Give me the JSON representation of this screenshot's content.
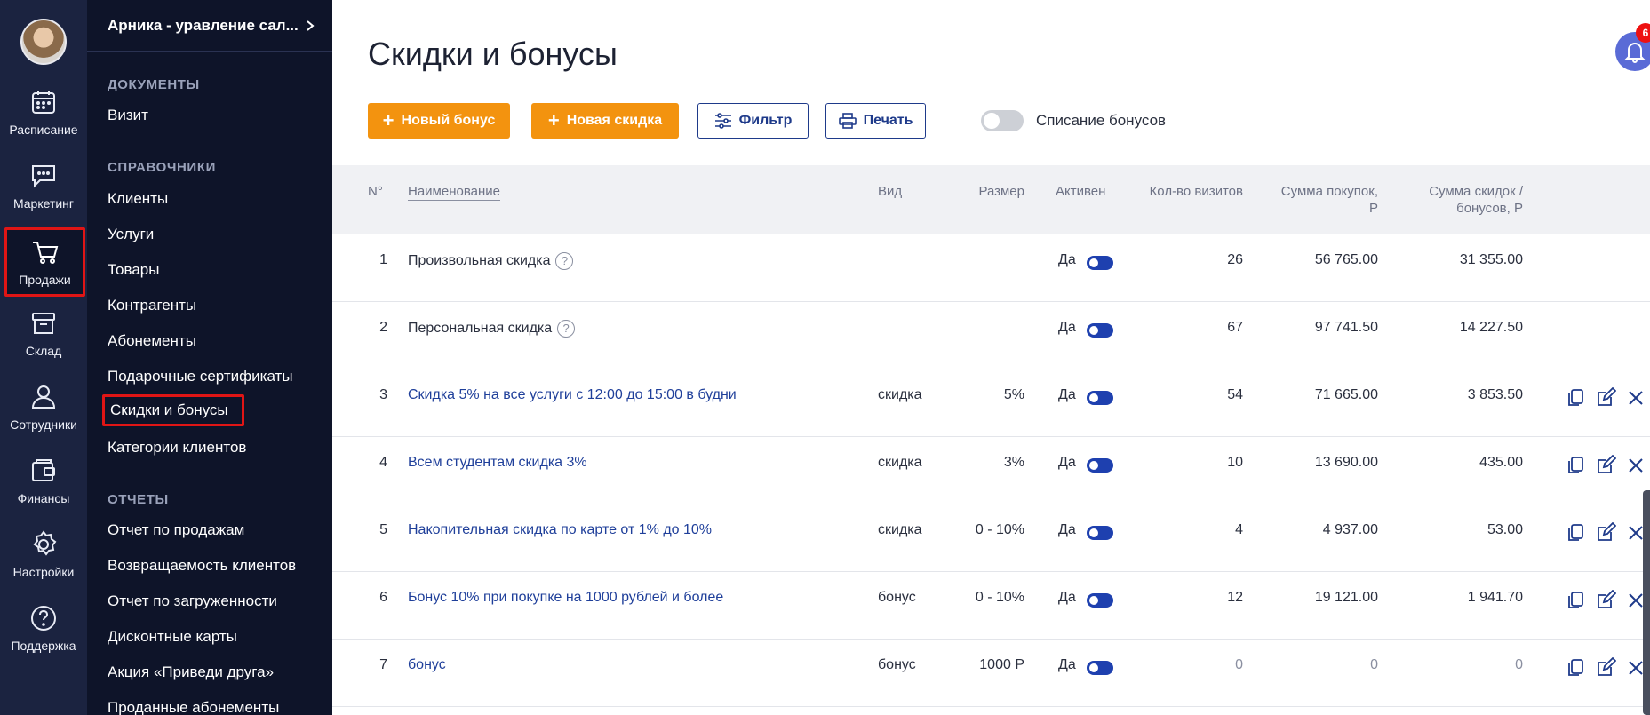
{
  "rail": {
    "items": [
      {
        "label": "Расписание",
        "icon": "calendar-icon"
      },
      {
        "label": "Маркетинг",
        "icon": "chat-icon"
      },
      {
        "label": "Продажи",
        "icon": "cart-icon"
      },
      {
        "label": "Склад",
        "icon": "archive-icon"
      },
      {
        "label": "Сотрудники",
        "icon": "person-icon"
      },
      {
        "label": "Финансы",
        "icon": "wallet-icon"
      },
      {
        "label": "Настройки",
        "icon": "gear-icon"
      },
      {
        "label": "Поддержка",
        "icon": "help-icon"
      }
    ]
  },
  "subnav": {
    "header": "Арника - уравление сал...",
    "sections": [
      {
        "title": "ДОКУМЕНТЫ",
        "links": [
          "Визит"
        ]
      },
      {
        "title": "СПРАВОЧНИКИ",
        "links": [
          "Клиенты",
          "Услуги",
          "Товары",
          "Контрагенты",
          "Абонементы",
          "Подарочные сертификаты",
          "Скидки и бонусы",
          "Категории клиентов"
        ]
      },
      {
        "title": "ОТЧЕТЫ",
        "links": [
          "Отчет по продажам",
          "Возвращаемость клиентов",
          "Отчет по загруженности",
          "Дисконтные карты",
          "Акция «Приведи друга»",
          "Проданные абонементы"
        ]
      }
    ]
  },
  "page": {
    "title": "Скидки и бонусы",
    "notifications_count": "6"
  },
  "toolbar": {
    "new_bonus": "Новый бонус",
    "new_discount": "Новая скидка",
    "filter": "Фильтр",
    "print": "Печать",
    "write_off_label": "Списание бонусов"
  },
  "table": {
    "headers": {
      "num": "N°",
      "name": "Наименование",
      "kind": "Вид",
      "size": "Размер",
      "active": "Активен",
      "visits": "Кол-во визитов",
      "purchases_1": "Сумма покупок,",
      "purchases_2": "Р",
      "discounts_1": "Сумма скидок /",
      "discounts_2": "бонусов, Р"
    },
    "rows": [
      {
        "num": "1",
        "name": "Произвольная скидка",
        "kind": "",
        "size": "",
        "active": "Да",
        "visits": "26",
        "purchases": "56 765.00",
        "discounts": "31 355.00"
      },
      {
        "num": "2",
        "name": "Персональная скидка",
        "kind": "",
        "size": "",
        "active": "Да",
        "visits": "67",
        "purchases": "97 741.50",
        "discounts": "14 227.50"
      },
      {
        "num": "3",
        "name": "Скидка 5% на все услуги с 12:00 до 15:00 в будни",
        "kind": "скидка",
        "size": "5%",
        "active": "Да",
        "visits": "54",
        "purchases": "71 665.00",
        "discounts": "3 853.50"
      },
      {
        "num": "4",
        "name": "Всем студентам скидка 3%",
        "kind": "скидка",
        "size": "3%",
        "active": "Да",
        "visits": "10",
        "purchases": "13 690.00",
        "discounts": "435.00"
      },
      {
        "num": "5",
        "name": "Накопительная скидка по карте от 1% до 10%",
        "kind": "скидка",
        "size": "0 - 10%",
        "active": "Да",
        "visits": "4",
        "purchases": "4 937.00",
        "discounts": "53.00"
      },
      {
        "num": "6",
        "name": "Бонус 10% при покупке на 1000 рублей и более",
        "kind": "бонус",
        "size": "0 - 10%",
        "active": "Да",
        "visits": "12",
        "purchases": "19 121.00",
        "discounts": "1 941.70"
      },
      {
        "num": "7",
        "name": "бонус",
        "kind": "бонус",
        "size": "1000 Р",
        "active": "Да",
        "visits": "0",
        "purchases": "0",
        "discounts": "0"
      }
    ]
  }
}
